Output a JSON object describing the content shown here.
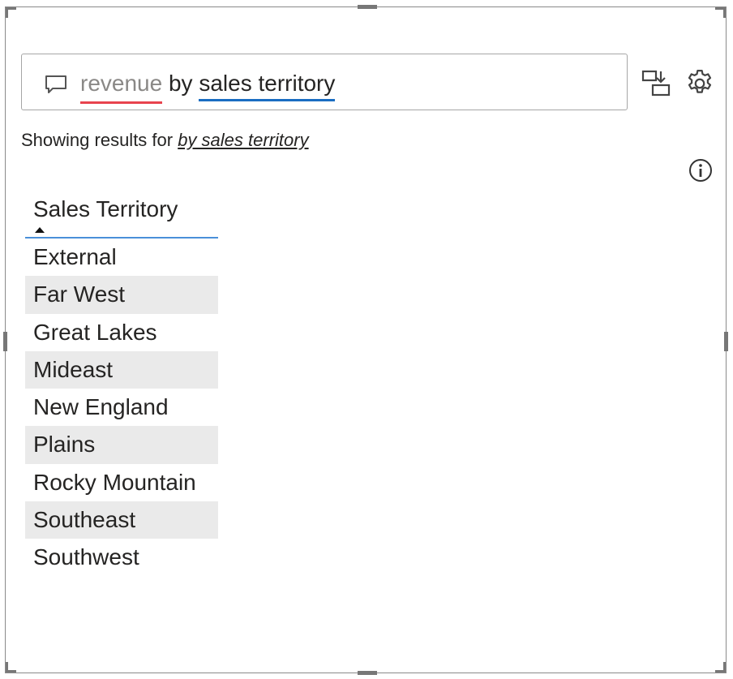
{
  "qa": {
    "query_term_1": "revenue",
    "query_connector": " by ",
    "query_term_2": "sales territory",
    "icons": {
      "chat": "chat-bubble-icon",
      "convert": "convert-to-visual-icon",
      "settings": "gear-icon",
      "info": "info-icon"
    }
  },
  "results": {
    "prefix": "Showing results for ",
    "link": "by sales territory"
  },
  "table": {
    "header": "Sales Territory",
    "sort": "ascending",
    "rows": [
      "External",
      "Far West",
      "Great Lakes",
      "Mideast",
      "New England",
      "Plains",
      "Rocky Mountain",
      "Southeast",
      "Southwest"
    ]
  },
  "colors": {
    "accent_blue": "#1a6dc2",
    "error_red": "#e8434e",
    "row_band": "#eaeaea"
  }
}
